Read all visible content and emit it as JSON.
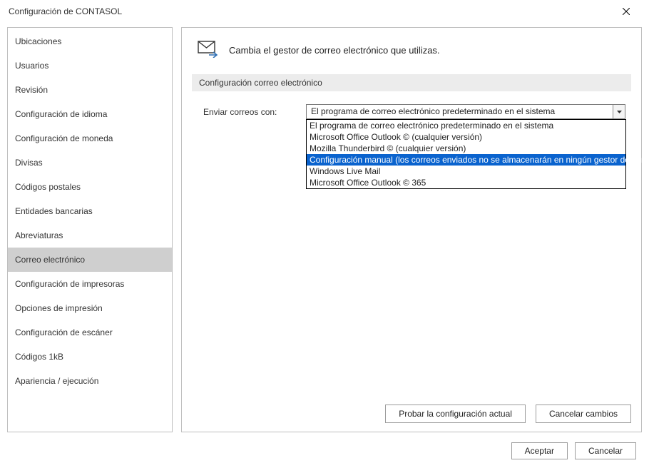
{
  "window": {
    "title": "Configuración de CONTASOL"
  },
  "sidebar": {
    "items": [
      {
        "label": "Ubicaciones"
      },
      {
        "label": "Usuarios"
      },
      {
        "label": "Revisión"
      },
      {
        "label": "Configuración de idioma"
      },
      {
        "label": "Configuración de moneda"
      },
      {
        "label": "Divisas"
      },
      {
        "label": "Códigos postales"
      },
      {
        "label": "Entidades bancarias"
      },
      {
        "label": "Abreviaturas"
      },
      {
        "label": "Correo electrónico"
      },
      {
        "label": "Configuración de impresoras"
      },
      {
        "label": "Opciones de impresión"
      },
      {
        "label": "Configuración de escáner"
      },
      {
        "label": "Códigos 1kB"
      },
      {
        "label": "Apariencia / ejecución"
      }
    ],
    "selected_index": 9
  },
  "main": {
    "heading": "Cambia el gestor de correo electrónico que utilizas.",
    "section_title": "Configuración correo electrónico",
    "field_label": "Enviar correos con:",
    "select_value": "El programa de correo electrónico predeterminado en el sistema",
    "dropdown_options": [
      "El programa de correo electrónico predeterminado en el sistema",
      "Microsoft Office Outlook © (cualquier versión)",
      "Mozilla Thunderbird © (cualquier versión)",
      "Configuración manual (los correos enviados no se almacenarán en ningún gestor de correo)",
      "Windows Live Mail",
      "Microsoft Office Outlook © 365"
    ],
    "dropdown_highlight_index": 3,
    "btn_test": "Probar la configuración actual",
    "btn_cancel_changes": "Cancelar cambios"
  },
  "footer": {
    "accept": "Aceptar",
    "cancel": "Cancelar"
  }
}
